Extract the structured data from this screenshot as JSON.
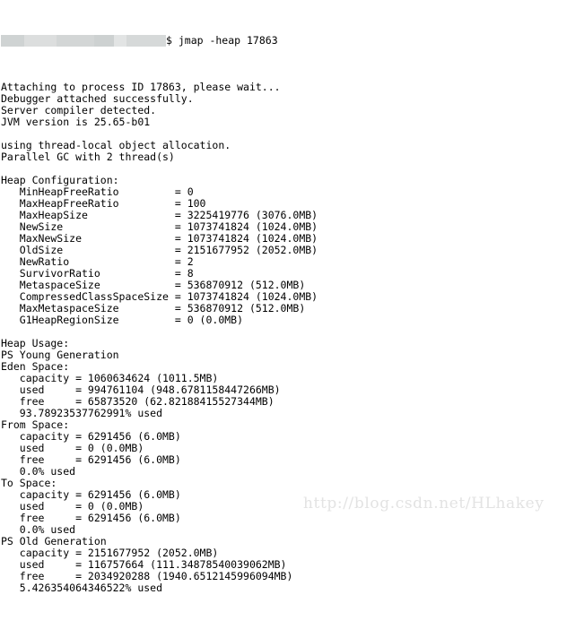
{
  "window": {
    "title": "jmap -heap 17863",
    "background_color": "#ffffff",
    "text_color": "#000000"
  },
  "prompt": {
    "redacted_label": "redacted-prompt",
    "command": "$ jmap -heap 17863"
  },
  "watermark": {
    "text": "http://blog.csdn.net/HLhakey",
    "color": "#e3e3e3"
  },
  "output": {
    "lines": [
      "Attaching to process ID 17863, please wait...",
      "Debugger attached successfully.",
      "Server compiler detected.",
      "JVM version is 25.65-b01",
      "",
      "using thread-local object allocation.",
      "Parallel GC with 2 thread(s)",
      "",
      "Heap Configuration:",
      "   MinHeapFreeRatio         = 0",
      "   MaxHeapFreeRatio         = 100",
      "   MaxHeapSize              = 3225419776 (3076.0MB)",
      "   NewSize                  = 1073741824 (1024.0MB)",
      "   MaxNewSize               = 1073741824 (1024.0MB)",
      "   OldSize                  = 2151677952 (2052.0MB)",
      "   NewRatio                 = 2",
      "   SurvivorRatio            = 8",
      "   MetaspaceSize            = 536870912 (512.0MB)",
      "   CompressedClassSpaceSize = 1073741824 (1024.0MB)",
      "   MaxMetaspaceSize         = 536870912 (512.0MB)",
      "   G1HeapRegionSize         = 0 (0.0MB)",
      "",
      "Heap Usage:",
      "PS Young Generation",
      "Eden Space:",
      "   capacity = 1060634624 (1011.5MB)",
      "   used     = 994761104 (948.6781158447266MB)",
      "   free     = 65873520 (62.82188415527344MB)",
      "   93.78923537762991% used",
      "From Space:",
      "   capacity = 6291456 (6.0MB)",
      "   used     = 0 (0.0MB)",
      "   free     = 6291456 (6.0MB)",
      "   0.0% used",
      "To Space:",
      "   capacity = 6291456 (6.0MB)",
      "   used     = 0 (0.0MB)",
      "   free     = 6291456 (6.0MB)",
      "   0.0% used",
      "PS Old Generation",
      "   capacity = 2151677952 (2052.0MB)",
      "   used     = 116757664 (111.34878540039062MB)",
      "   free     = 2034920288 (1940.6512145996094MB)",
      "   5.426354064346522% used"
    ]
  },
  "heap_configuration": {
    "MinHeapFreeRatio": "0",
    "MaxHeapFreeRatio": "100",
    "MaxHeapSize": "3225419776 (3076.0MB)",
    "NewSize": "1073741824 (1024.0MB)",
    "MaxNewSize": "1073741824 (1024.0MB)",
    "OldSize": "2151677952 (2052.0MB)",
    "NewRatio": "2",
    "SurvivorRatio": "8",
    "MetaspaceSize": "536870912 (512.0MB)",
    "CompressedClassSpaceSize": "1073741824 (1024.0MB)",
    "MaxMetaspaceSize": "536870912 (512.0MB)",
    "G1HeapRegionSize": "0 (0.0MB)"
  },
  "heap_usage": {
    "collector": "PS Young Generation",
    "eden_space": {
      "capacity": "1060634624 (1011.5MB)",
      "used": "994761104 (948.6781158447266MB)",
      "free": "65873520 (62.82188415527344MB)",
      "percent_used": "93.78923537762991% used"
    },
    "from_space": {
      "capacity": "6291456 (6.0MB)",
      "used": "0 (0.0MB)",
      "free": "6291456 (6.0MB)",
      "percent_used": "0.0% used"
    },
    "to_space": {
      "capacity": "6291456 (6.0MB)",
      "used": "0 (0.0MB)",
      "free": "6291456 (6.0MB)",
      "percent_used": "0.0% used"
    },
    "old_generation": {
      "name": "PS Old Generation",
      "capacity": "2151677952 (2052.0MB)",
      "used": "116757664 (111.34878540039062MB)",
      "free": "2034920288 (1940.6512145996094MB)",
      "percent_used": "5.426354064346522% used"
    }
  }
}
